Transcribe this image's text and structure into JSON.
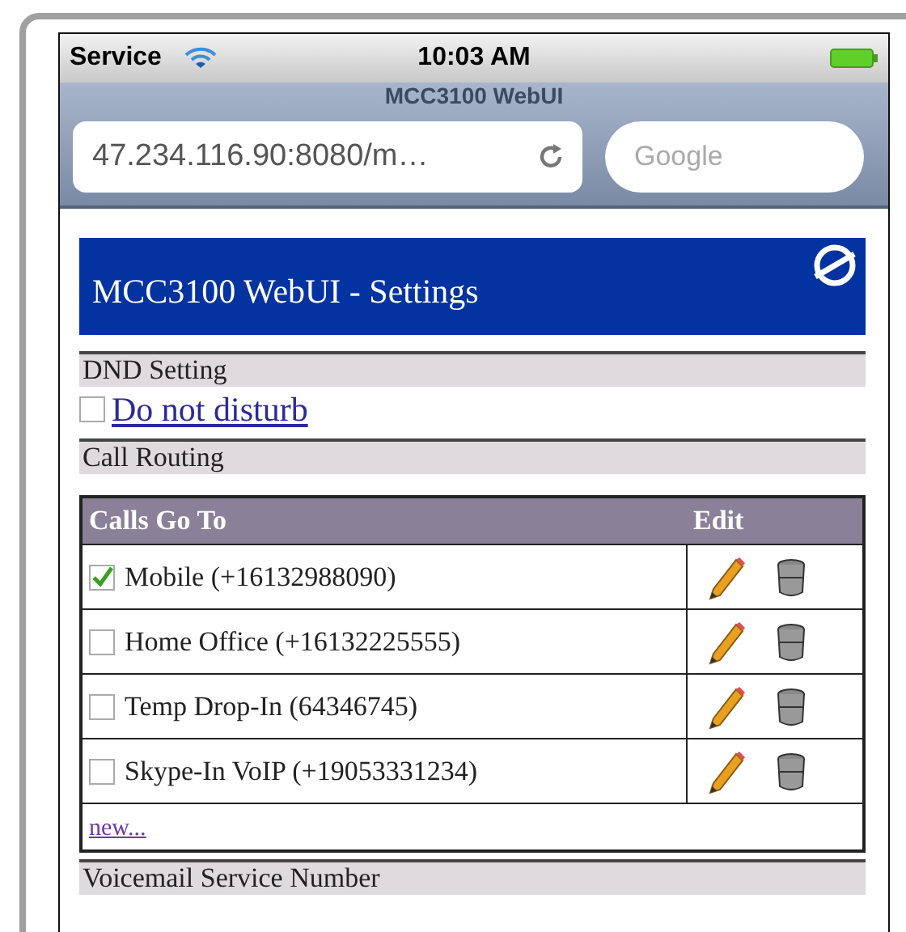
{
  "status_bar": {
    "carrier": "Service",
    "time": "10:03 AM"
  },
  "browser": {
    "page_title": "MCC3100 WebUI",
    "url": "47.234.116.90:8080/m…",
    "search_placeholder": "Google"
  },
  "page": {
    "header": "MCC3100 WebUI - Settings",
    "dnd": {
      "heading": "DND Setting",
      "label": "Do not disturb",
      "checked": false
    },
    "routing": {
      "heading": "Call Routing",
      "columns": [
        "Calls Go To",
        "Edit"
      ],
      "rows": [
        {
          "label": "Mobile (+16132988090)",
          "checked": true
        },
        {
          "label": "Home Office (+16132225555)",
          "checked": false
        },
        {
          "label": "Temp Drop-In (64346745)",
          "checked": false
        },
        {
          "label": "Skype-In VoIP (+19053331234)",
          "checked": false
        }
      ],
      "new_link": "new..."
    },
    "voicemail": {
      "heading": "Voicemail Service Number"
    }
  }
}
